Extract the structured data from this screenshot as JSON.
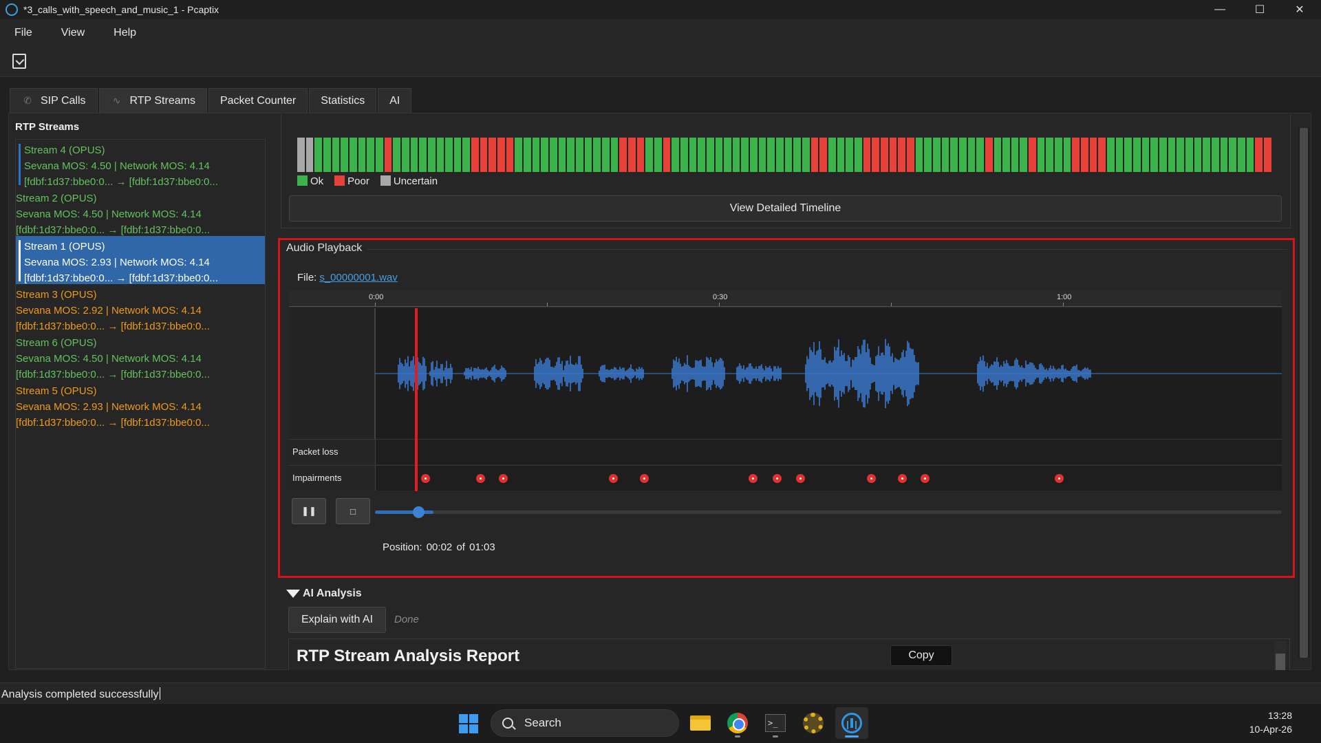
{
  "window": {
    "title": "*3_calls_with_speech_and_music_1 - Pcaptix",
    "controls": [
      "minimize",
      "maximize",
      "close"
    ]
  },
  "menu": {
    "items": [
      "File",
      "View",
      "Help"
    ]
  },
  "toolbar": {
    "export_icon": "export-icon"
  },
  "tabs": [
    {
      "label": "SIP Calls",
      "icon": "phone-icon"
    },
    {
      "label": "RTP Streams",
      "icon": "waveform-icon",
      "active": true
    },
    {
      "label": "Packet Counter"
    },
    {
      "label": "Statistics"
    },
    {
      "label": "AI"
    }
  ],
  "left_panel": {
    "title": "RTP Streams",
    "streams": [
      {
        "name": "Stream 4 (OPUS)",
        "mos": "Sevana MOS: 4.50 | Network MOS: 4.14",
        "addr": "[fdbf:1d37:bbe0:0... → [fdbf:1d37:bbe0:0...",
        "quality": "good"
      },
      {
        "name": "Stream 2 (OPUS)",
        "mos": "Sevana MOS: 4.50 | Network MOS: 4.14",
        "addr": "[fdbf:1d37:bbe0:0... → [fdbf:1d37:bbe0:0...",
        "quality": "good"
      },
      {
        "name": "Stream 1 (OPUS)",
        "mos": "Sevana MOS: 2.93 | Network MOS: 4.14",
        "addr": "[fdbf:1d37:bbe0:0... → [fdbf:1d37:bbe0:0...",
        "quality": "poor",
        "selected": true
      },
      {
        "name": "Stream 3 (OPUS)",
        "mos": "Sevana MOS: 2.92 | Network MOS: 4.14",
        "addr": "[fdbf:1d37:bbe0:0... → [fdbf:1d37:bbe0:0...",
        "quality": "poor"
      },
      {
        "name": "Stream 6 (OPUS)",
        "mos": "Sevana MOS: 4.50 | Network MOS: 4.14",
        "addr": "[fdbf:1d37:bbe0:0... → [fdbf:1d37:bbe0:0...",
        "quality": "good"
      },
      {
        "name": "Stream 5 (OPUS)",
        "mos": "Sevana MOS: 2.93 | Network MOS: 4.14",
        "addr": "[fdbf:1d37:bbe0:0... → [fdbf:1d37:bbe0:0...",
        "quality": "poor"
      }
    ]
  },
  "quality_timeline": {
    "segments": "UUGGGGGGGGPGGGGGGGGGPPPPPGGGGGGGGGGGGPPPGGPGGGGGGGGGGGGGGGGPPGGGGPPPPPPGGGGGGGGPGGGGPGGGGPPPPGGGGGGGGGGGGGGGGGPP",
    "legend": {
      "ok": "Ok",
      "poor": "Poor",
      "uncertain": "Uncertain"
    },
    "colors": {
      "ok": "#3cb44b",
      "poor": "#e8413a",
      "uncertain": "#a8a8a8"
    },
    "button_label": "View Detailed Timeline"
  },
  "playback": {
    "title": "Audio Playback",
    "file_label": "File:",
    "file_name": "s_00000001.wav",
    "time_ticks": [
      "0:00",
      "0:30",
      "1:00"
    ],
    "tracks": {
      "packet_loss": "Packet loss",
      "impairments": "Impairments"
    },
    "impairment_times": [
      4.3,
      9.1,
      11.1,
      20.7,
      23.4,
      32.9,
      35.0,
      37.0,
      43.2,
      45.9,
      47.9,
      59.6
    ],
    "duration_seconds": 63,
    "position_seconds": 2,
    "buttons": {
      "play_pause_icon": "play-pause-icon",
      "stop_icon": "stop-icon"
    },
    "position_label": "Position:",
    "position_value": "00:02",
    "of_label": "of",
    "duration": "01:03",
    "colors": {
      "waveform": "#3b7ad0",
      "playhead": "#e11d1d",
      "impairment": "#e33131"
    }
  },
  "ai_analysis": {
    "title": "AI Analysis",
    "explain_button": "Explain with AI",
    "status": "Done",
    "report_title": "RTP Stream Analysis Report",
    "copy_button": "Copy"
  },
  "statusbar": {
    "text": "Analysis completed successfully"
  },
  "taskbar": {
    "search_placeholder": "Search",
    "apps": [
      "file-explorer-icon",
      "chrome-icon",
      "terminal-icon",
      "settings-gear-icon",
      "pcaptix-icon"
    ],
    "time": "13:28",
    "date": "10-Apr-26"
  }
}
